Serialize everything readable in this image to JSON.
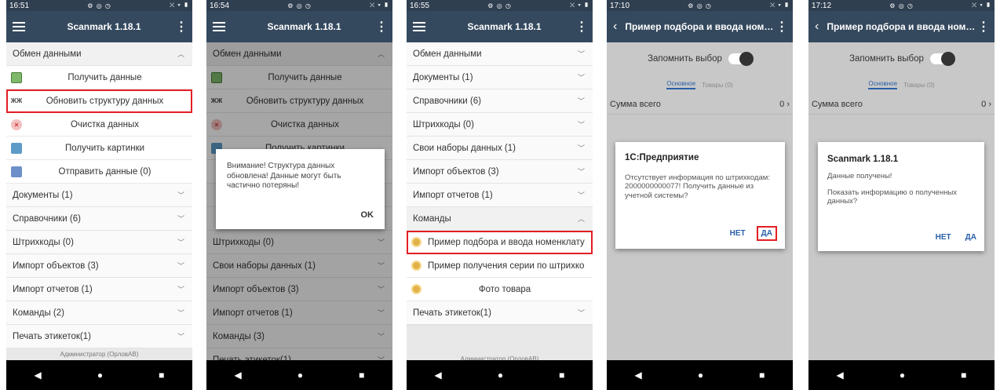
{
  "panel1": {
    "time": "16:51",
    "status_icons": "⚙ ◎ ◷",
    "sys_icons": "⛌ ▾ ▮",
    "title": "Scanmark 1.18.1",
    "exchange_header": "Обмен данными",
    "sub_items": [
      "Получить данные",
      "Обновить структуру данных",
      "Очистка данных",
      "Получить картинки",
      "Отправить данные (0)"
    ],
    "sections": [
      "Документы (1)",
      "Справочники (6)",
      "Штрихкоды (0)",
      "Импорт объектов (3)",
      "Импорт отчетов (1)",
      "Команды (2)",
      "Печать этикеток(1)"
    ],
    "footer": "Администратор (ОрловАВ)"
  },
  "panel2": {
    "time": "16:54",
    "title": "Scanmark 1.18.1",
    "exchange_header": "Обмен данными",
    "sub_items": [
      "Получить данные",
      "Обновить структуру данных",
      "Очистка данных",
      "Получить картинки"
    ],
    "sections": [
      "Штрихкоды (0)",
      "Свои наборы данных (1)",
      "Импорт объектов (3)",
      "Импорт отчетов (1)",
      "Команды (3)",
      "Печать этикеток(1)"
    ],
    "dialog_text": "Внимание! Структура данных обновлена! Данные могут быть частично потеряны!",
    "dialog_ok": "OK"
  },
  "panel3": {
    "time": "16:55",
    "title": "Scanmark 1.18.1",
    "sections": [
      "Обмен данными",
      "Документы (1)",
      "Справочники (6)",
      "Штрихкоды (0)",
      "Свои наборы данных (1)",
      "Импорт объектов (3)",
      "Импорт отчетов (1)"
    ],
    "commands_header": "Команды",
    "commands": [
      "Пример подбора и ввода номенклату",
      "Пример получения серии по штрихко",
      "Фото товара"
    ],
    "print_section": "Печать этикеток(1)",
    "footer": "Администратор (ОрловАВ)"
  },
  "panel4": {
    "time": "17:10",
    "title": "Пример подбора и ввода номен...",
    "remember": "Запомнить выбор",
    "tab_main": "Основное",
    "tab_goods": "Товары (0)",
    "sum_label": "Сумма всего",
    "sum_value": "0",
    "dialog_title": "1С:Предприятие",
    "dialog_text": "Отсутствует информация по штрихкодам: 2000000000077! Получить данные из учетной системы?",
    "no": "НЕТ",
    "yes": "ДА"
  },
  "panel5": {
    "time": "17:12",
    "title": "Пример подбора и ввода номе...",
    "remember": "Запомнить выбор",
    "tab_main": "Основное",
    "tab_goods": "Товары (0)",
    "sum_label": "Сумма всего",
    "sum_value": "0",
    "dialog_title": "Scanmark 1.18.1",
    "dialog_line1": "Данные получены!",
    "dialog_line2": "Показать информацию о полученных данных?",
    "no": "НЕТ",
    "yes": "ДА"
  },
  "nav": {
    "back": "◀",
    "home": "●",
    "recent": "■"
  },
  "colors": {
    "appbar": "#35495e",
    "highlight": "#e31e24",
    "link_blue": "#2a5fa8"
  }
}
